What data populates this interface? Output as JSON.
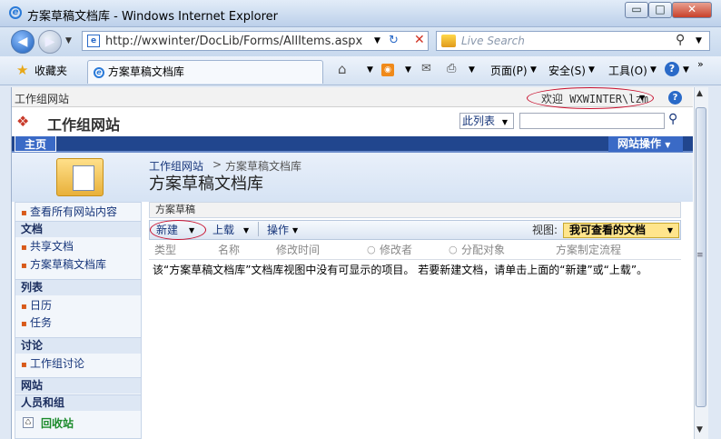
{
  "window": {
    "title": "方案草稿文档库 - Windows Internet Explorer",
    "min": "▭",
    "max": "□",
    "close": "✕"
  },
  "address": {
    "url": "http://wxwinter/DocLib/Forms/AllItems.aspx",
    "search_placeholder": "Live Search"
  },
  "commandbar": {
    "favorites": "收藏夹",
    "tab": "方案草稿文档库",
    "page": "页面(P)",
    "safety": "安全(S)",
    "tools": "工具(O)"
  },
  "sharepoint": {
    "global_site": "工作组网站",
    "welcome": "欢迎 WXWINTER\\lzm",
    "site_title": "工作组网站",
    "scope": "此列表",
    "home_tab": "主页",
    "site_actions": "网站操作",
    "breadcrumb_root": "工作组网站",
    "breadcrumb_sep": ">",
    "breadcrumb_current": "方案草稿文档库",
    "page_title": "方案草稿文档库",
    "left_nav": {
      "view_all": "查看所有网站内容",
      "docs_head": "文档",
      "docs": [
        "共享文档",
        "方案草稿文档库"
      ],
      "lists_head": "列表",
      "lists": [
        "日历",
        "任务"
      ],
      "disc_head": "讨论",
      "discussions": [
        "工作组讨论"
      ],
      "sites_head": "网站",
      "people_head": "人员和组",
      "recycle": "回收站"
    },
    "library_title": "方案草稿",
    "toolbar": {
      "new": "新建",
      "upload": "上载",
      "actions": "操作",
      "view_label": "视图:",
      "view_value": "我可查看的文档"
    },
    "columns": [
      "类型",
      "名称",
      "修改时间",
      "修改者",
      "分配对象",
      "方案制定流程"
    ],
    "empty_message": "该“方案草稿文档库”文档库视图中没有可显示的项目。 若要新建文档，请单击上面的“新建”或“上载”。"
  },
  "colors": {
    "accent": "#21468e",
    "annotation": "#c8102e"
  }
}
